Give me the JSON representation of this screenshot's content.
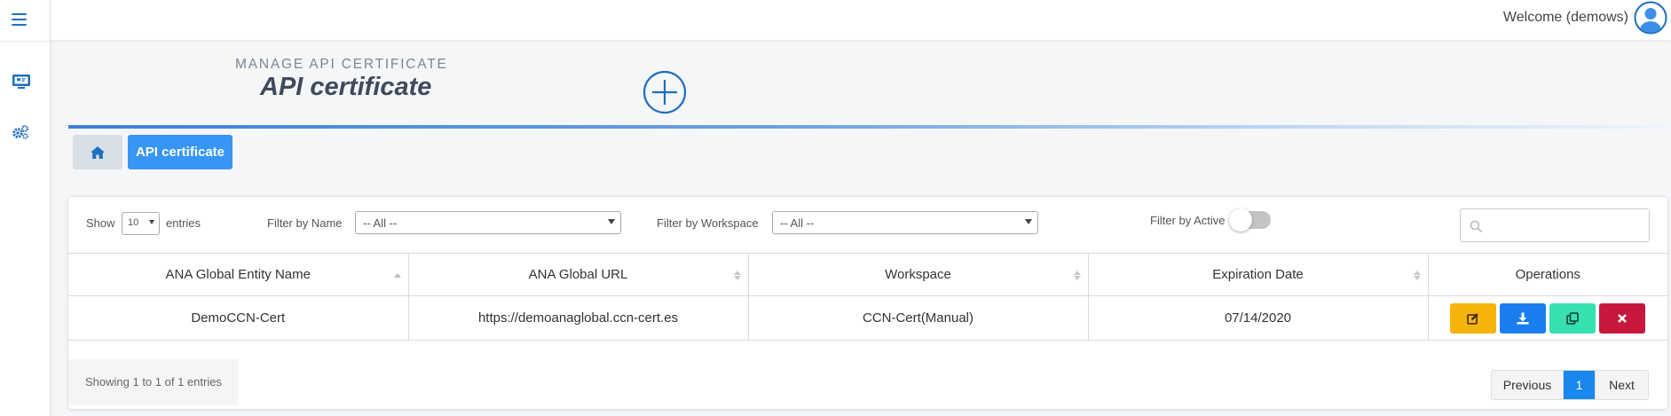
{
  "header": {
    "welcome": "Welcome (demows)"
  },
  "sidebar": {
    "items": [
      {
        "icon": "hamburger-icon"
      },
      {
        "icon": "monitor-icon"
      },
      {
        "icon": "gears-icon"
      }
    ]
  },
  "page": {
    "subtitle": "MANAGE API CERTIFICATE",
    "title": "API certificate"
  },
  "breadcrumb": {
    "home_icon": "home-icon",
    "current": "API certificate"
  },
  "controls": {
    "show_label": "Show",
    "entries_value": "10",
    "entries_label": "entries",
    "filter_name_label": "Filter by Name",
    "filter_name_value": "-- All --",
    "filter_workspace_label": "Filter by Workspace",
    "filter_workspace_value": "-- All --",
    "filter_active_label": "Filter by Active",
    "filter_active_on": false,
    "search_placeholder": ""
  },
  "table": {
    "headers": [
      "ANA Global Entity Name",
      "ANA Global URL",
      "Workspace",
      "Expiration Date",
      "Operations"
    ],
    "rows": [
      {
        "name": "DemoCCN-Cert",
        "url": "https://demoanaglobal.ccn-cert.es",
        "workspace": "CCN-Cert(Manual)",
        "expiration": "07/14/2020"
      }
    ],
    "operations": [
      {
        "name": "edit",
        "icon": "edit-icon",
        "color": "#f6b30a"
      },
      {
        "name": "download",
        "icon": "download-icon",
        "color": "#1a7df0"
      },
      {
        "name": "copy",
        "icon": "copy-icon",
        "color": "#36e0b0"
      },
      {
        "name": "delete",
        "icon": "close-icon",
        "color": "#c6173c"
      }
    ]
  },
  "footer": {
    "info": "Showing 1 to 1 of 1 entries",
    "prev": "Previous",
    "current_page": "1",
    "next": "Next"
  },
  "colors": {
    "accent": "#3795f3",
    "primary_blue": "#1a86f0",
    "sidebar_icon": "#1f6fbf"
  }
}
